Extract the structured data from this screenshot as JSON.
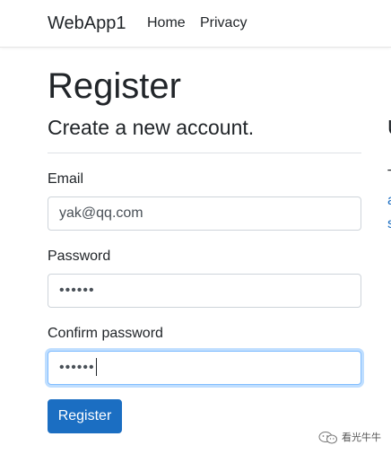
{
  "navbar": {
    "brand": "WebApp1",
    "links": [
      {
        "label": "Home"
      },
      {
        "label": "Privacy"
      }
    ]
  },
  "page": {
    "title": "Register",
    "subtitle": "Create a new account."
  },
  "form": {
    "email": {
      "label": "Email",
      "value": "yak@qq.com"
    },
    "password": {
      "label": "Password",
      "masked_value": "••••••"
    },
    "confirm_password": {
      "label": "Confirm password",
      "masked_value": "••••••",
      "focused": true
    },
    "submit_label": "Register"
  },
  "side_panel_fragment": {
    "heading_char": "U",
    "line1_char": "T",
    "line2_char": "a",
    "line3_char": "s"
  },
  "watermark": {
    "text": "看光牛牛",
    "icon": "wechat-icon"
  },
  "colors": {
    "primary": "#1b6ec2",
    "focus_border": "#80bdff",
    "text": "#212529",
    "border": "#ced4da"
  }
}
